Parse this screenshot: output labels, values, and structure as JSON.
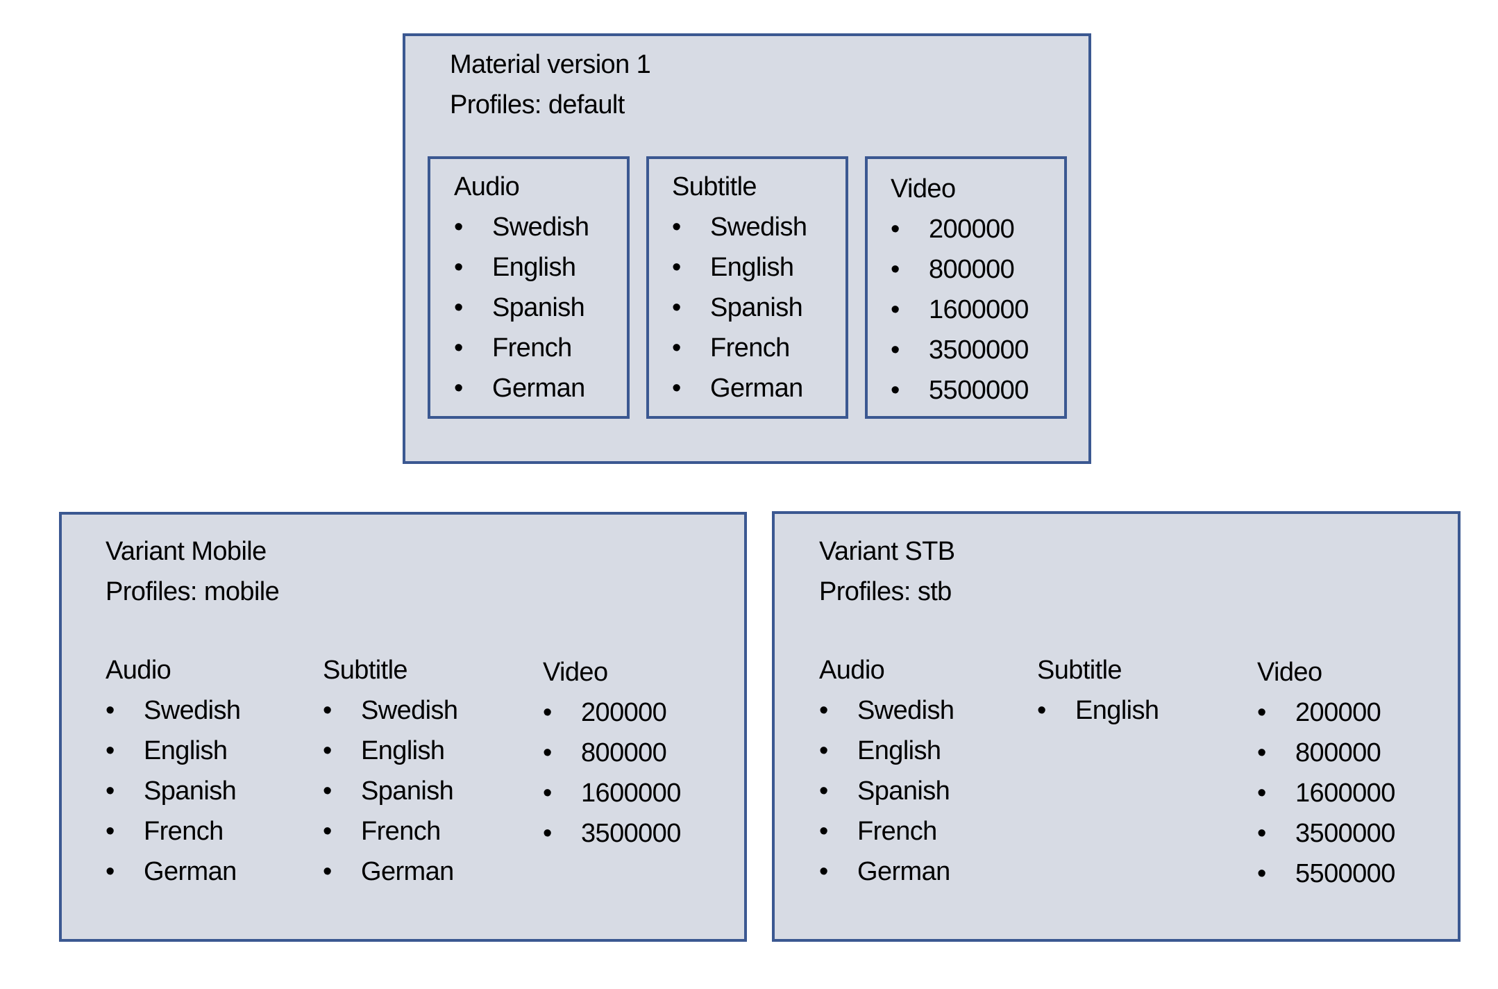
{
  "material": {
    "title": "Material version 1",
    "profiles": "Profiles: default",
    "audio": {
      "heading": "Audio",
      "items": [
        "Swedish",
        "English",
        "Spanish",
        "French",
        "German"
      ]
    },
    "subtitle": {
      "heading": "Subtitle",
      "items": [
        "Swedish",
        "English",
        "Spanish",
        "French",
        "German"
      ]
    },
    "video": {
      "heading": "Video",
      "items": [
        "200000",
        "800000",
        "1600000",
        "3500000",
        "5500000"
      ]
    }
  },
  "variant_mobile": {
    "title": "Variant Mobile",
    "profiles": "Profiles: mobile",
    "audio": {
      "heading": "Audio",
      "items": [
        "Swedish",
        "English",
        "Spanish",
        "French",
        "German"
      ]
    },
    "subtitle": {
      "heading": "Subtitle",
      "items": [
        "Swedish",
        "English",
        "Spanish",
        "French",
        "German"
      ]
    },
    "video": {
      "heading": "Video",
      "items": [
        "200000",
        "800000",
        "1600000",
        "3500000"
      ]
    }
  },
  "variant_stb": {
    "title": "Variant STB",
    "profiles": "Profiles: stb",
    "audio": {
      "heading": "Audio",
      "items": [
        "Swedish",
        "English",
        "Spanish",
        "French",
        "German"
      ]
    },
    "subtitle": {
      "heading": "Subtitle",
      "items": [
        "English"
      ]
    },
    "video": {
      "heading": "Video",
      "items": [
        "200000",
        "800000",
        "1600000",
        "3500000",
        "5500000"
      ]
    }
  },
  "bullet_glyph": "•",
  "colors": {
    "box_fill": "#d7dbe4",
    "box_border": "#3b5891",
    "text": "#000000"
  }
}
